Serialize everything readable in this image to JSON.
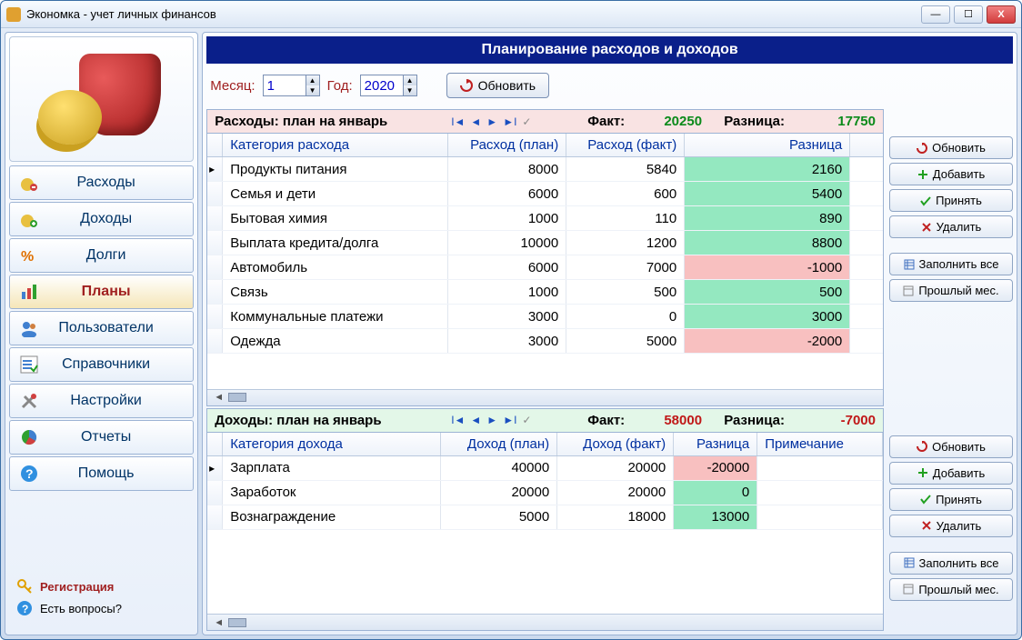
{
  "window": {
    "title": "Экономка - учет личных финансов"
  },
  "sidebar": {
    "items": [
      {
        "label": "Расходы"
      },
      {
        "label": "Доходы"
      },
      {
        "label": "Долги"
      },
      {
        "label": "Планы"
      },
      {
        "label": "Пользователи"
      },
      {
        "label": "Справочники"
      },
      {
        "label": "Настройки"
      },
      {
        "label": "Отчеты"
      },
      {
        "label": "Помощь"
      }
    ],
    "active_index": 3,
    "register": "Регистрация",
    "questions": "Есть вопросы?"
  },
  "page": {
    "title": "Планирование расходов и доходов",
    "month_label": "Месяц:",
    "month_value": "1",
    "year_label": "Год:",
    "year_value": "2020",
    "refresh": "Обновить"
  },
  "expenses": {
    "header_title": "Расходы: план на январь",
    "fact_label": "Факт:",
    "fact_value": "20250",
    "diff_label": "Разница:",
    "diff_value": "17750",
    "columns": {
      "cat": "Категория расхода",
      "plan": "Расход (план)",
      "fact": "Расход (факт)",
      "diff": "Разница"
    },
    "rows": [
      {
        "cat": "Продукты питания",
        "plan": "8000",
        "fact": "5840",
        "diff": "2160",
        "pos": true
      },
      {
        "cat": "Семья и дети",
        "plan": "6000",
        "fact": "600",
        "diff": "5400",
        "pos": true
      },
      {
        "cat": "Бытовая химия",
        "plan": "1000",
        "fact": "110",
        "diff": "890",
        "pos": true
      },
      {
        "cat": "Выплата кредита/долга",
        "plan": "10000",
        "fact": "1200",
        "diff": "8800",
        "pos": true
      },
      {
        "cat": "Автомобиль",
        "plan": "6000",
        "fact": "7000",
        "diff": "-1000",
        "pos": false
      },
      {
        "cat": "Связь",
        "plan": "1000",
        "fact": "500",
        "diff": "500",
        "pos": true
      },
      {
        "cat": "Коммунальные платежи",
        "plan": "3000",
        "fact": "0",
        "diff": "3000",
        "pos": true
      },
      {
        "cat": "Одежда",
        "plan": "3000",
        "fact": "5000",
        "diff": "-2000",
        "pos": false
      }
    ]
  },
  "income": {
    "header_title": "Доходы: план на январь",
    "fact_label": "Факт:",
    "fact_value": "58000",
    "diff_label": "Разница:",
    "diff_value": "-7000",
    "columns": {
      "cat": "Категория дохода",
      "plan": "Доход (план)",
      "fact": "Доход (факт)",
      "diff": "Разница",
      "note": "Примечание"
    },
    "rows": [
      {
        "cat": "Зарплата",
        "plan": "40000",
        "fact": "20000",
        "diff": "-20000",
        "pos": false
      },
      {
        "cat": "Заработок",
        "plan": "20000",
        "fact": "20000",
        "diff": "0",
        "pos": true
      },
      {
        "cat": "Вознаграждение",
        "plan": "5000",
        "fact": "18000",
        "diff": "13000",
        "pos": true
      }
    ]
  },
  "side_buttons": {
    "refresh": "Обновить",
    "add": "Добавить",
    "accept": "Принять",
    "delete": "Удалить",
    "fill_all": "Заполнить все",
    "prev_month": "Прошлый мес."
  }
}
